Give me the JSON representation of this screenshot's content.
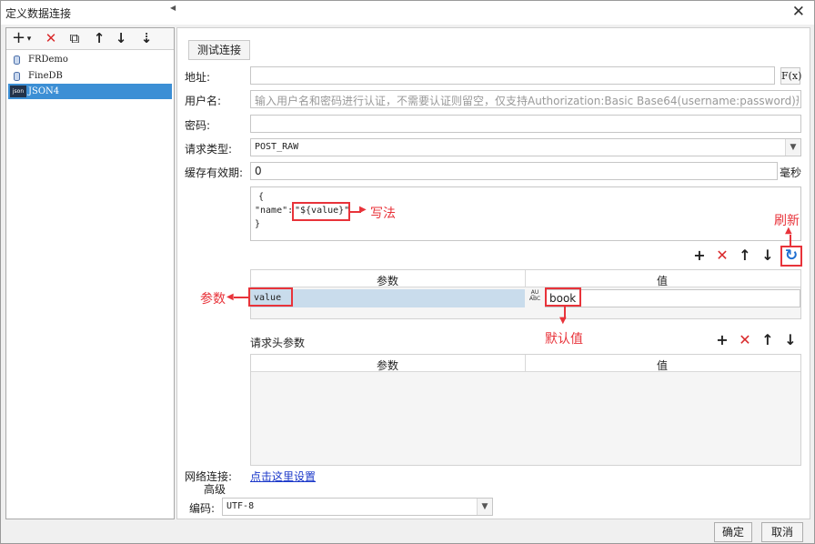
{
  "window": {
    "title": "定义数据连接",
    "close": "✕"
  },
  "left_toolbar": {
    "add": "+",
    "add_caret": "▾",
    "delete": "✕",
    "copy": "⧉",
    "up": "↑",
    "down": "↓",
    "sort": "⇣"
  },
  "datasources": [
    {
      "name": "FRDemo",
      "icon": "database-icon"
    },
    {
      "name": "FineDB",
      "icon": "database-icon"
    },
    {
      "name": "JSON4",
      "icon": "json-icon",
      "badge": "json",
      "selected": true
    }
  ],
  "test_button": "测试连接",
  "form": {
    "address_label": "地址:",
    "address_value": "",
    "fx_button": "F(x)",
    "username_label": "用户名:",
    "username_placeholder": "输入用户名和密码进行认证，不需要认证则留空，仅支持Authorization:Basic Base64(username:password)形式",
    "password_label": "密码:",
    "password_value": "",
    "request_type_label": "请求类型:",
    "request_type_value": "POST_RAW",
    "cache_label": "缓存有效期:",
    "cache_value": "0",
    "cache_unit": "毫秒"
  },
  "body_editor": {
    "line1": "{",
    "line2_key": "\"name\":",
    "line2_value": "\"${value}\"",
    "line3": "}"
  },
  "params_toolbar": {
    "add": "+",
    "delete": "✕",
    "up": "↑",
    "down": "↓",
    "refresh": "↻"
  },
  "params_table": {
    "col_param": "参数",
    "col_value": "值",
    "rows": [
      {
        "param": "value",
        "type_icon": "ABC",
        "value": "book"
      }
    ]
  },
  "headers_section": {
    "label": "请求头参数",
    "toolbar": {
      "add": "+",
      "delete": "✕",
      "up": "↑",
      "down": "↓"
    },
    "col_param": "参数",
    "col_value": "值"
  },
  "network": {
    "label": "网络连接:",
    "link": "点击这里设置"
  },
  "advanced": {
    "label": "高级",
    "encoding_label": "编码:",
    "encoding_value": "UTF-8"
  },
  "annotations": {
    "syntax": "写法",
    "refresh": "刷新",
    "param": "参数",
    "default_value": "默认值"
  },
  "buttons": {
    "ok": "确定",
    "cancel": "取消"
  },
  "colors": {
    "selection": "#3c8fd5",
    "annotation": "#e8333a",
    "refresh_icon": "#1f6fd1",
    "param_row": "#c9dcec"
  }
}
